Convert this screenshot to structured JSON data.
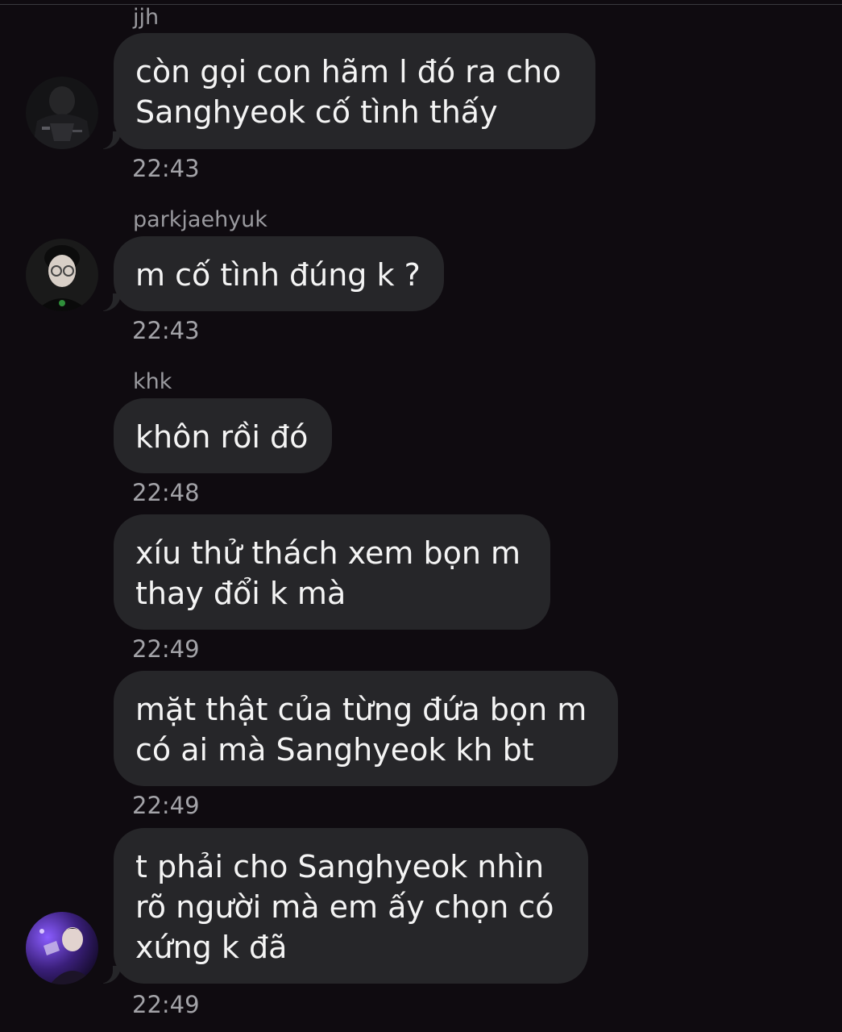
{
  "messages": [
    {
      "sender": "jjh",
      "lines": [
        "còn gọi con hãm l đó ra cho",
        "Sanghyeok cố tình thấy"
      ],
      "time": "22:43",
      "avatar": "avatar-dark-jacket"
    },
    {
      "sender": "parkjaehyuk",
      "lines": [
        "m cố tình đúng k ?"
      ],
      "time": "22:43",
      "avatar": "avatar-glasses"
    },
    {
      "sender": "khk",
      "lines": [
        "khôn rồi đó"
      ],
      "time": "22:48"
    },
    {
      "lines": [
        "xíu thử thách xem bọn m",
        "thay đổi k mà"
      ],
      "time": "22:49"
    },
    {
      "lines": [
        "mặt thật của từng đứa bọn m",
        "có ai mà Sanghyeok kh bt"
      ],
      "time": "22:49"
    },
    {
      "lines": [
        "t phải cho Sanghyeok nhìn",
        "rõ người mà em ấy chọn có",
        "xứng k đã"
      ],
      "time": "22:49",
      "avatar": "avatar-purple-photo"
    }
  ],
  "colors": {
    "background": "#0f0b10",
    "bubble": "#262629",
    "sender_text": "#9a9a9f",
    "time_text": "#a3a3a8",
    "message_text": "#f4f4f4"
  }
}
